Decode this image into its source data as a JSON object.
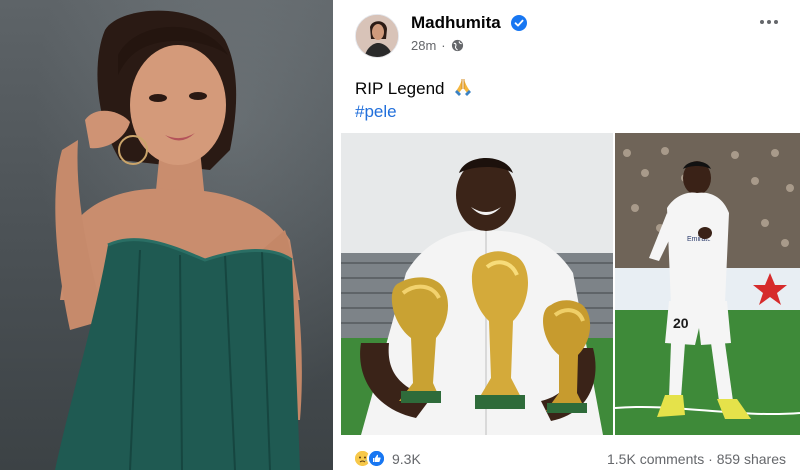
{
  "post": {
    "author": "Madhumita",
    "time": "28m",
    "separator": "·",
    "text": "RIP Legend",
    "hashtag": "#pele",
    "reactions_count": "9.3K",
    "comments": "1.5K comments",
    "stats_separator": "·",
    "shares": "859 shares"
  },
  "icons": {
    "verified": "verified-badge-icon",
    "audience": "globe-icon",
    "more": "more-options-icon",
    "pray": "pray-emoji-icon",
    "reactions": [
      "sad-reaction-icon",
      "like-reaction-icon"
    ]
  },
  "colors": {
    "link": "#216fdb",
    "verified": "#1877f2",
    "secondary_text": "#65676b",
    "primary_text": "#050505"
  },
  "jersey": {
    "number": "20",
    "sponsor": "Emirates"
  }
}
